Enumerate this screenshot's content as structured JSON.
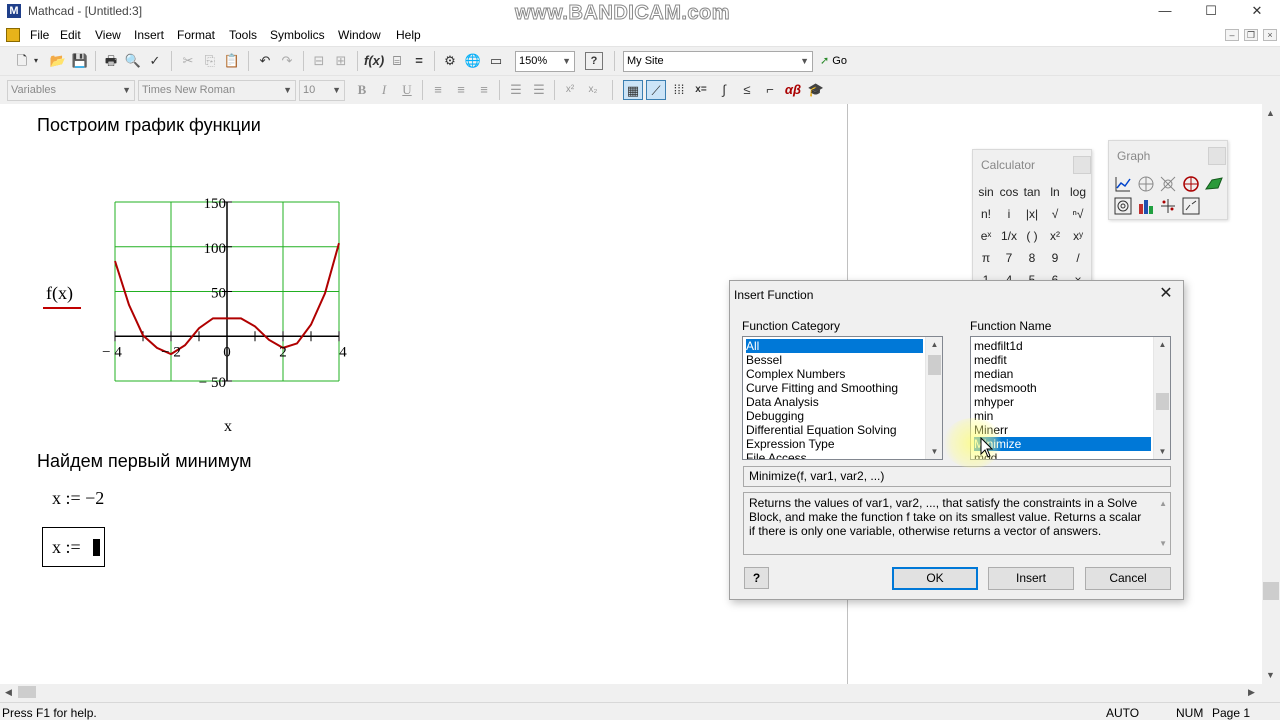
{
  "window": {
    "title": "Mathcad - [Untitled:3]",
    "watermark": "www.BANDICAM.com",
    "minimize": "—",
    "maximize": "☐",
    "close": "✕"
  },
  "menu": {
    "items": [
      "File",
      "Edit",
      "View",
      "Insert",
      "Format",
      "Tools",
      "Symbolics",
      "Window",
      "Help"
    ]
  },
  "toolbar": {
    "zoom": "150%",
    "url": "My Site",
    "go_label": "Go",
    "style": "Variables",
    "font": "Times New Roman",
    "font_size": "10"
  },
  "document": {
    "heading1": "Построим график функции",
    "heading2": "Найдем первый минимум",
    "y_expr": "f(x)",
    "x_expr": "x",
    "assign1": "x := −2",
    "assign2": "x := "
  },
  "chart_data": {
    "type": "line",
    "title": "",
    "xlabel": "x",
    "ylabel": "f(x)",
    "xlim": [
      -4,
      4
    ],
    "ylim": [
      -50,
      150
    ],
    "x_ticks": [
      "− 4",
      "− 2",
      "0",
      "2",
      "4"
    ],
    "y_ticks": [
      "150",
      "100",
      "50",
      "− 50"
    ],
    "grid": true,
    "series": [
      {
        "color": "#b00000",
        "x": [
          -4,
          -3.5,
          -3,
          -2.5,
          -2,
          -1.5,
          -1,
          -0.5,
          0,
          0.5,
          1,
          1.5,
          2,
          2.5,
          3,
          3.5,
          4
        ],
        "y": [
          84,
          35,
          1,
          -13,
          -20,
          -10,
          9,
          20,
          20,
          20,
          11,
          -4,
          -13,
          -8,
          13,
          48,
          104
        ]
      }
    ]
  },
  "calculator": {
    "title": "Calculator",
    "keys": [
      "sin",
      "cos",
      "tan",
      "ln",
      "log",
      "n!",
      "i",
      "|x|",
      "√",
      "ⁿ√",
      "eˣ",
      "1/x",
      "( )",
      "x²",
      "xʸ",
      "π",
      "7",
      "8",
      "9",
      "/",
      "1",
      "4",
      "5",
      "6",
      "×"
    ]
  },
  "graph_palette": {
    "title": "Graph"
  },
  "dialog": {
    "title": "Insert Function",
    "category_label": "Function Category",
    "name_label": "Function Name",
    "categories": [
      "All",
      "Bessel",
      "Complex Numbers",
      "Curve Fitting and Smoothing",
      "Data Analysis",
      "Debugging",
      "Differential Equation Solving",
      "Expression Type",
      "File Access"
    ],
    "selected_category": 0,
    "names": [
      "medfilt1d",
      "medfit",
      "median",
      "medsmooth",
      "mhyper",
      "min",
      "Minerr",
      "Minimize",
      "mod"
    ],
    "selected_name": 7,
    "signature": "Minimize(f, var1, var2, ...)",
    "description": "Returns the values of var1, var2, ..., that satisfy the constraints in a Solve Block, and make the function f take on its smallest value. Returns a scalar if there is only one variable, otherwise returns a vector of answers.",
    "help": "?",
    "ok": "OK",
    "insert": "Insert",
    "cancel": "Cancel"
  },
  "status": {
    "help": "Press F1 for help.",
    "mode": "AUTO",
    "num": "NUM",
    "page": "Page 1"
  }
}
